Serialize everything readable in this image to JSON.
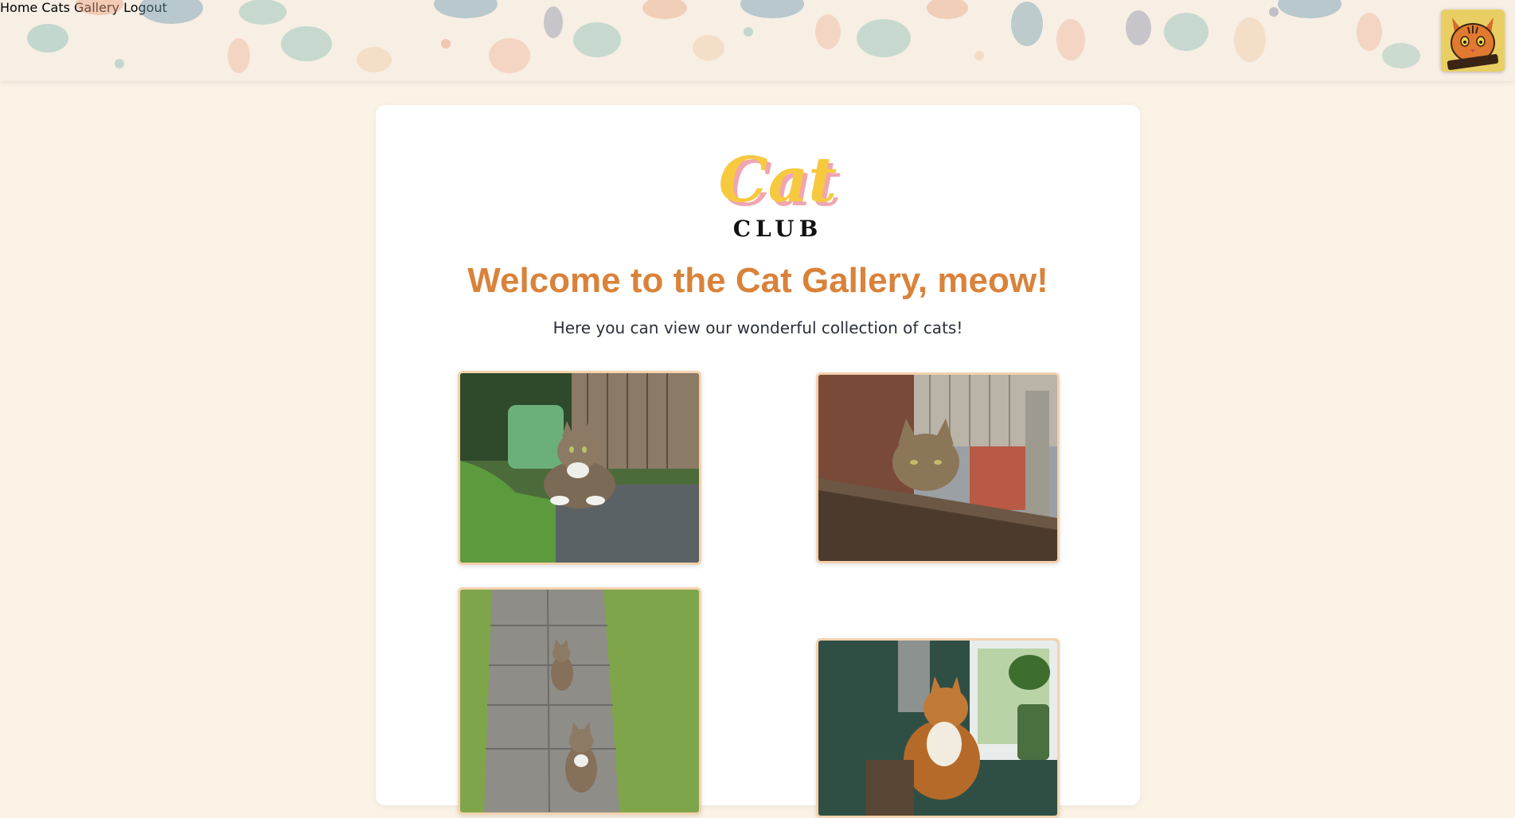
{
  "nav": {
    "home": "Home",
    "gallery": "Cats Gallery",
    "logout": "Logout"
  },
  "avatar_icon": "orange-cat-avatar-icon",
  "logo": {
    "word1": "Cat",
    "word2": "CLUB"
  },
  "main": {
    "title": "Welcome to the Cat Gallery, meow!",
    "subtitle": "Here you can view our wonderful collection of cats!"
  },
  "gallery": [
    {
      "subject": "tabby cat on step near grass"
    },
    {
      "subject": "tabby cat resting on wooden bench"
    },
    {
      "subject": "two tabby cats on garden path"
    },
    {
      "subject": "fluffy orange cat by window"
    }
  ],
  "colors": {
    "background": "#fbf3e6",
    "nav_text": "#f5c542",
    "title": "#d9823a",
    "photo_border": "#f4d2ad"
  }
}
